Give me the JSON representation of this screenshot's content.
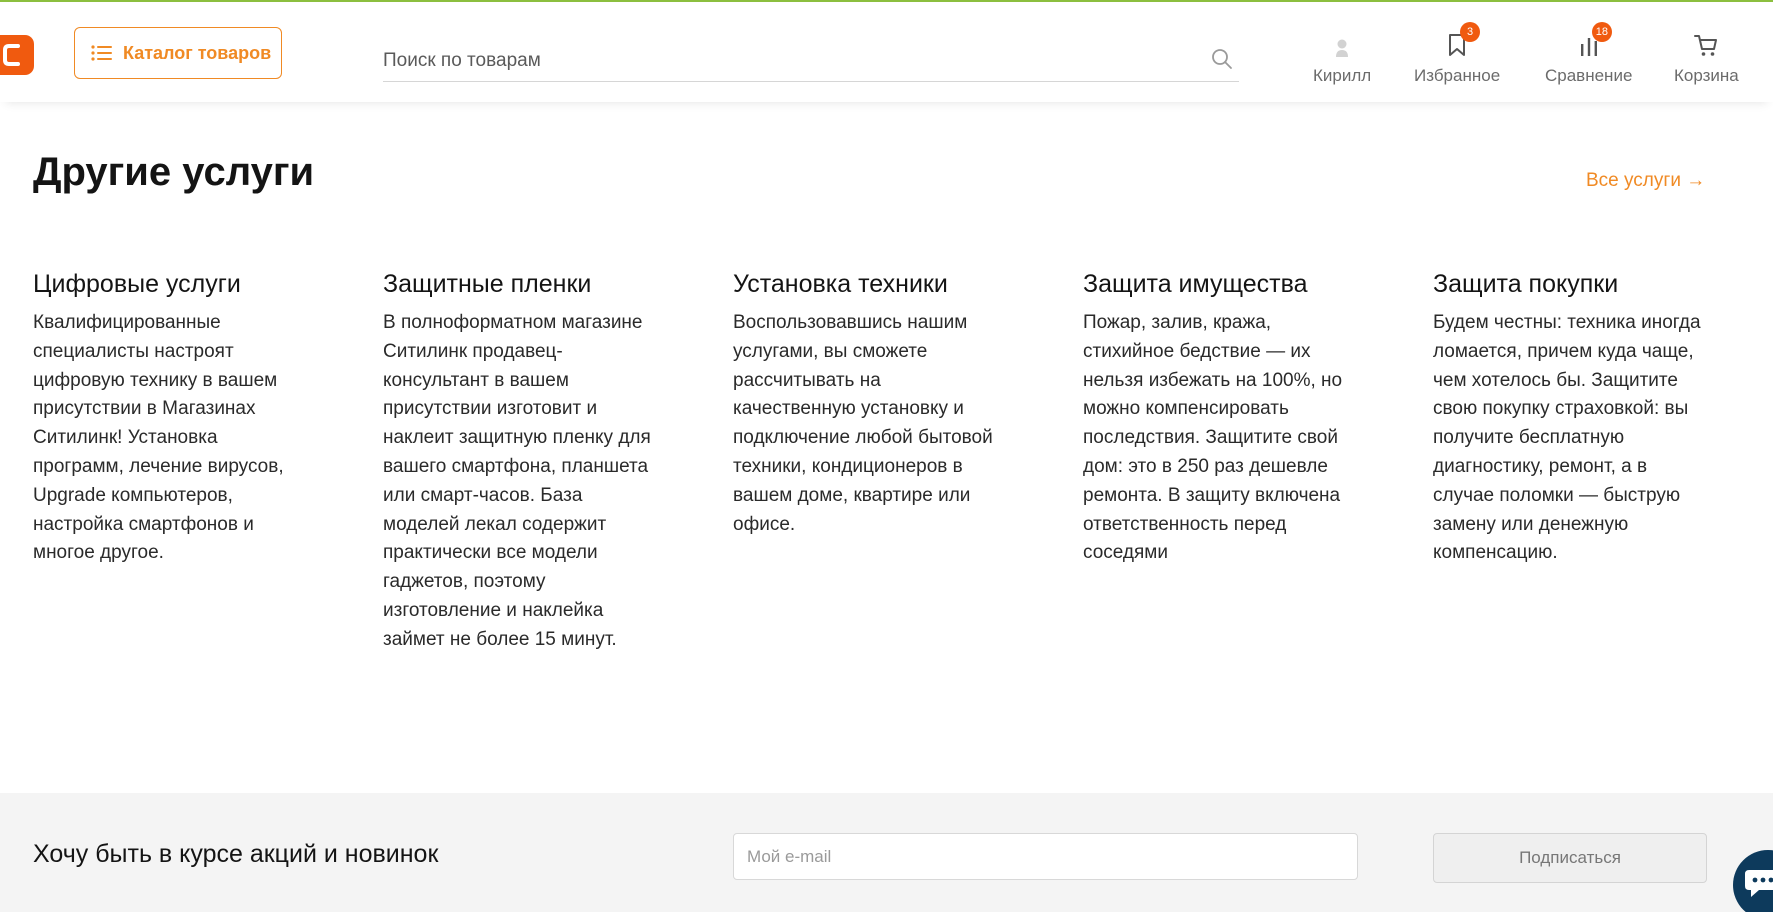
{
  "colors": {
    "accent": "#f08a24",
    "brand_logo": "#f05a0f",
    "top_line": "#8cbf3f",
    "chat_button": "#0d3a5c"
  },
  "header": {
    "catalog_label": "Каталог товаров",
    "search_placeholder": "Поиск по товарам",
    "user_label": "Кирилл",
    "favorites_label": "Избранное",
    "favorites_count": "3",
    "compare_label": "Сравнение",
    "compare_count": "18",
    "cart_label": "Корзина"
  },
  "services": {
    "title": "Другие услуги",
    "all_link": "Все услуги →",
    "items": [
      {
        "title": "Цифровые услуги",
        "text": "Квалифицированные специалисты настроят цифровую технику в вашем присутствии в Магазинах Ситилинк! Установка программ, лечение вирусов, Upgrade компьютеров, настройка смартфонов и многое другое."
      },
      {
        "title": "Защитные пленки",
        "text": "В полноформатном магазине Ситилинк продавец-консультант в вашем присутствии изготовит и наклеит защитную пленку для вашего смартфона, планшета или смарт-часов. База моделей лекал содержит практически все модели гаджетов, поэтому изготовление и наклейка займет не более 15 минут."
      },
      {
        "title": "Установка техники",
        "text": "Воспользовавшись нашим услугами, вы сможете рассчитывать на качественную установку и подключение любой бытовой техники, кондиционеров в вашем доме, квартире или офисе."
      },
      {
        "title": "Защита имущества",
        "text": "Пожар, залив, кража, стихийное бедствие — их нельзя избежать на 100%, но можно компенсировать последствия. Защитите свой дом: это в 250 раз дешевле ремонта. В защиту включена ответственность перед соседями"
      },
      {
        "title": "Защита покупки",
        "text": "Будем честны: техника иногда ломается, причем куда чаще, чем хотелось бы. Защитите свою покупку страховкой: вы получите бесплатную диагностику, ремонт, а в случае поломки — быструю замену или денежную компенсацию."
      }
    ]
  },
  "subscribe": {
    "title": "Хочу быть в курсе акций и новинок",
    "email_placeholder": "Мой e-mail",
    "email_value": "",
    "button_label": "Подписаться"
  },
  "icons": {
    "logo": "citilink-logo",
    "catalog": "list-icon",
    "search": "search-icon",
    "user": "user-icon",
    "favorites": "bookmark-icon",
    "compare": "compare-bars-icon",
    "cart": "cart-icon",
    "chat": "chat-icon"
  }
}
